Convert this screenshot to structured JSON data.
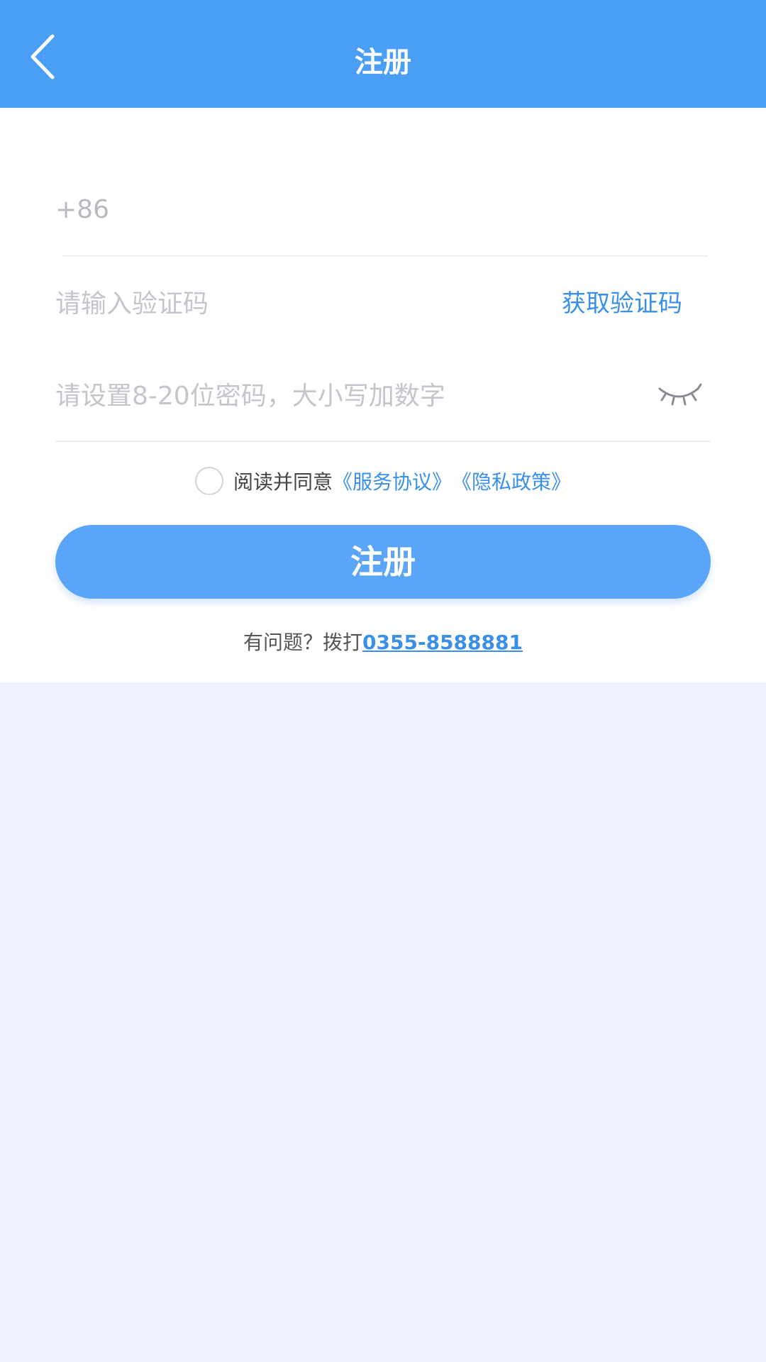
{
  "header": {
    "title": "注册",
    "back_icon": "chevron-left-icon"
  },
  "form": {
    "phone": {
      "prefix": "+86",
      "value": "",
      "placeholder": ""
    },
    "code": {
      "placeholder": "请输入验证码",
      "button_label": "获取验证码"
    },
    "password": {
      "placeholder": "请设置8-20位密码，大小写加数字",
      "toggle_icon": "eye-closed-icon"
    }
  },
  "agreement": {
    "checked": false,
    "prefix": "阅读并同意",
    "service_link": "《服务协议》",
    "privacy_link": "《隐私政策》"
  },
  "submit": {
    "label": "注册"
  },
  "help": {
    "prefix": "有问题？拨打",
    "phone": "0355-8588881"
  },
  "colors": {
    "header_bg": "#4b9ef5",
    "button_bg": "#5aa5f7",
    "link": "#3a8fe8",
    "page_bg": "#eef2fd"
  }
}
